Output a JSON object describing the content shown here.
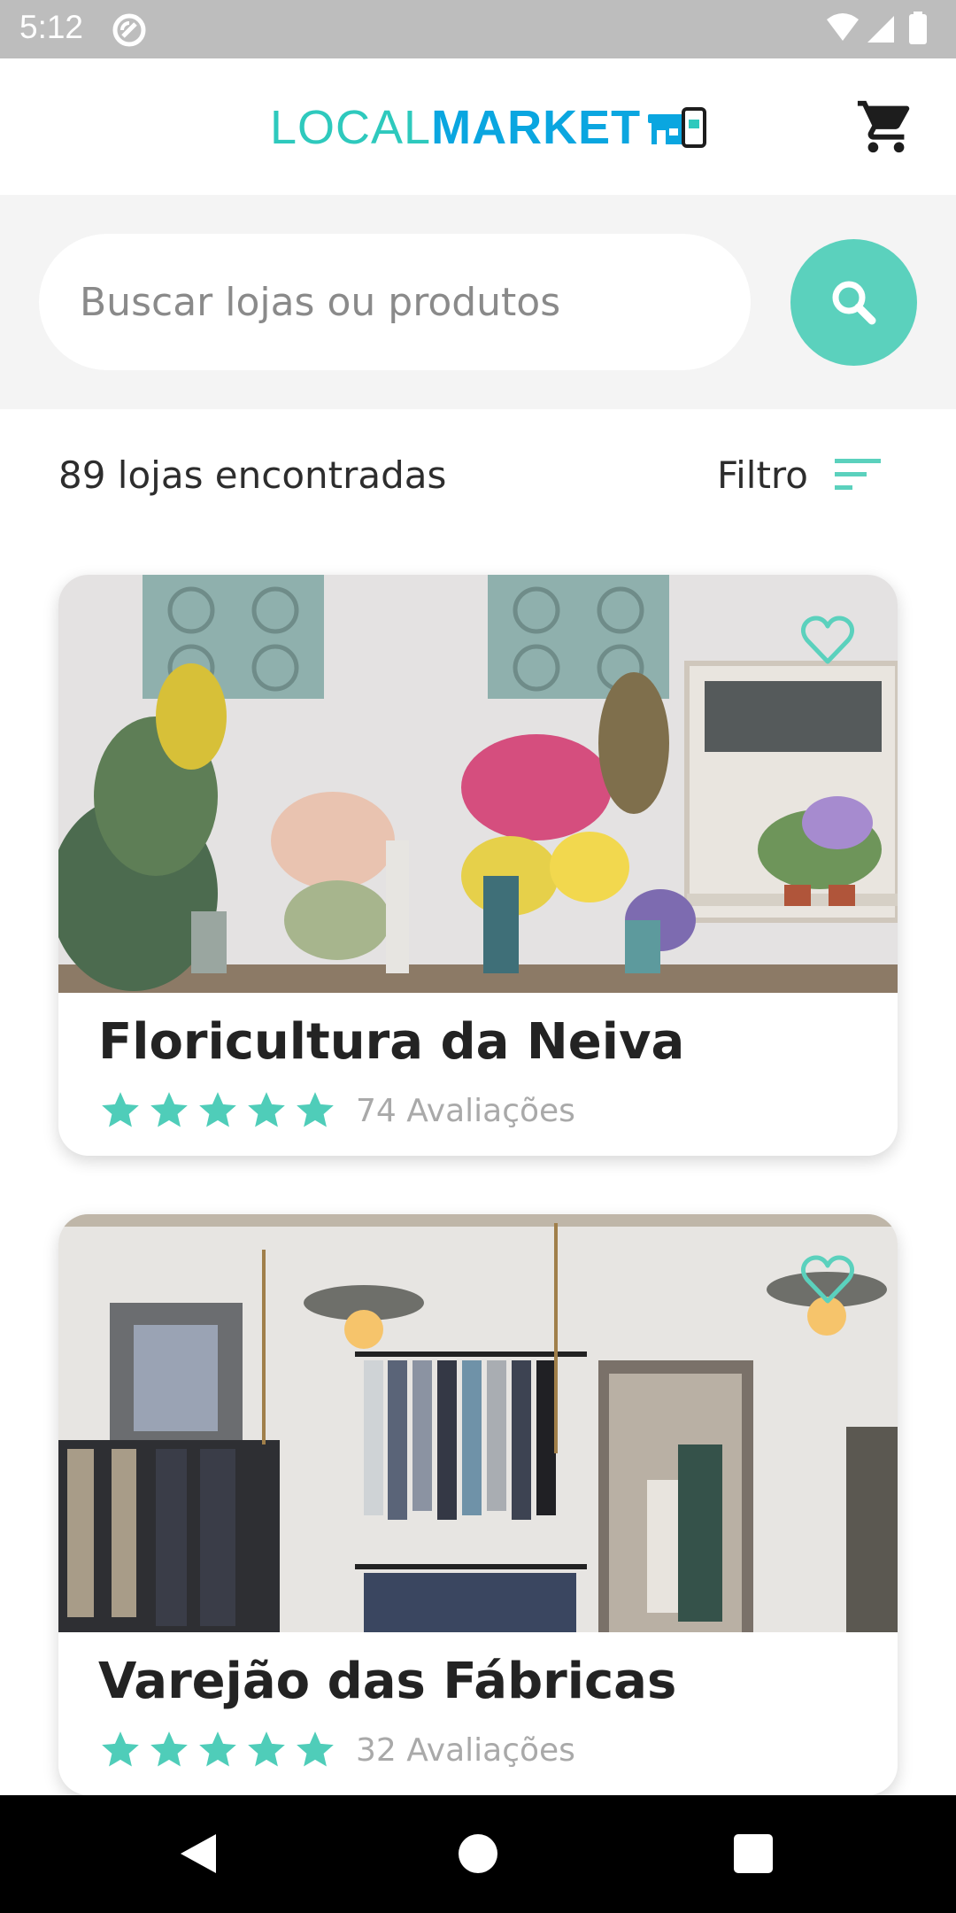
{
  "status_bar": {
    "time": "5:12",
    "icons": [
      "sync-icon",
      "wifi-icon",
      "cellular-icon",
      "battery-icon"
    ]
  },
  "app_bar": {
    "logo_part1": "LOCAL",
    "logo_part2": "MARKET",
    "cart_icon": "cart-icon"
  },
  "search": {
    "placeholder": "Buscar lojas ou produtos",
    "button_icon": "search-icon"
  },
  "results": {
    "count_label": "89 lojas encontradas",
    "filter_label": "Filtro",
    "filter_icon": "filter-sort-icon"
  },
  "stores": [
    {
      "name": "Floricultura da Neiva",
      "rating": 5,
      "reviews": "74 Avaliações",
      "image_subject": "flower shop interior",
      "favorite_icon": "heart-outline-icon"
    },
    {
      "name": "Varejão das Fábricas",
      "rating": 5,
      "reviews": "32 Avaliações",
      "image_subject": "clothing store interior",
      "favorite_icon": "heart-outline-icon"
    }
  ],
  "colors": {
    "accent": "#5bd1bd",
    "logo_teal": "#2ec9bd",
    "logo_blue": "#0aa6e0",
    "star": "#4fcdb9"
  },
  "nav_bar": {
    "icons": [
      "back-icon",
      "home-icon",
      "recents-icon"
    ]
  }
}
